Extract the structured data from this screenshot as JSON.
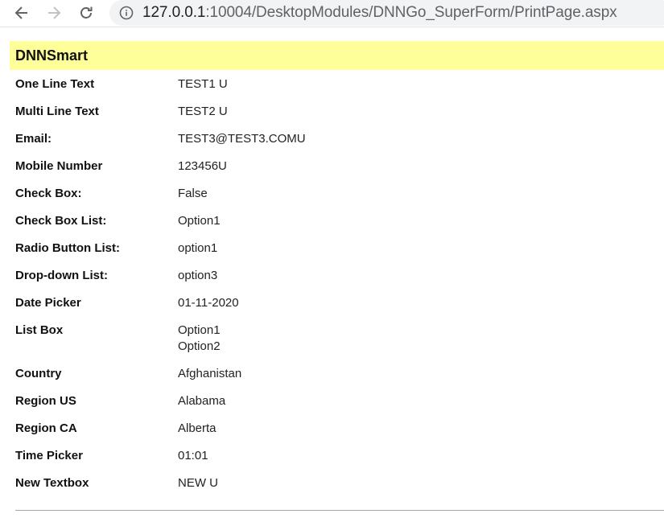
{
  "browser": {
    "url_host": "127.0.0.1",
    "url_rest": ":10004/DesktopModules/DNNGo_SuperForm/PrintPage.aspx",
    "icons": {
      "back": "arrow-left-icon",
      "forward": "arrow-right-icon",
      "reload": "reload-icon",
      "info": "info-circle-icon"
    }
  },
  "form": {
    "title": "DNNSmart",
    "header_color": "#ffff99",
    "fields": {
      "one_line_text": {
        "label": "One Line Text",
        "value": "TEST1 U"
      },
      "multi_line_text": {
        "label": "Multi Line Text",
        "value": "TEST2 U"
      },
      "email": {
        "label": "Email:",
        "value": "TEST3@TEST3.COMU"
      },
      "mobile_number": {
        "label": "Mobile Number",
        "value": "123456U"
      },
      "check_box": {
        "label": "Check Box:",
        "value": "False"
      },
      "check_box_list": {
        "label": "Check Box List:",
        "value": "Option1"
      },
      "radio_button_list": {
        "label": "Radio Button List:",
        "value": "option1"
      },
      "drop_down_list": {
        "label": "Drop-down List:",
        "value": "option3"
      },
      "date_picker": {
        "label": "Date Picker",
        "value": "01-11-2020"
      },
      "list_box": {
        "label": "List Box",
        "values": [
          "Option1",
          "Option2"
        ]
      },
      "country": {
        "label": "Country",
        "value": "Afghanistan"
      },
      "region_us": {
        "label": "Region US",
        "value": "Alabama"
      },
      "region_ca": {
        "label": "Region CA",
        "value": "Alberta"
      },
      "time_picker": {
        "label": "Time Picker",
        "value": "01:01"
      },
      "new_textbox": {
        "label": "New Textbox",
        "value": "NEW U"
      }
    }
  }
}
